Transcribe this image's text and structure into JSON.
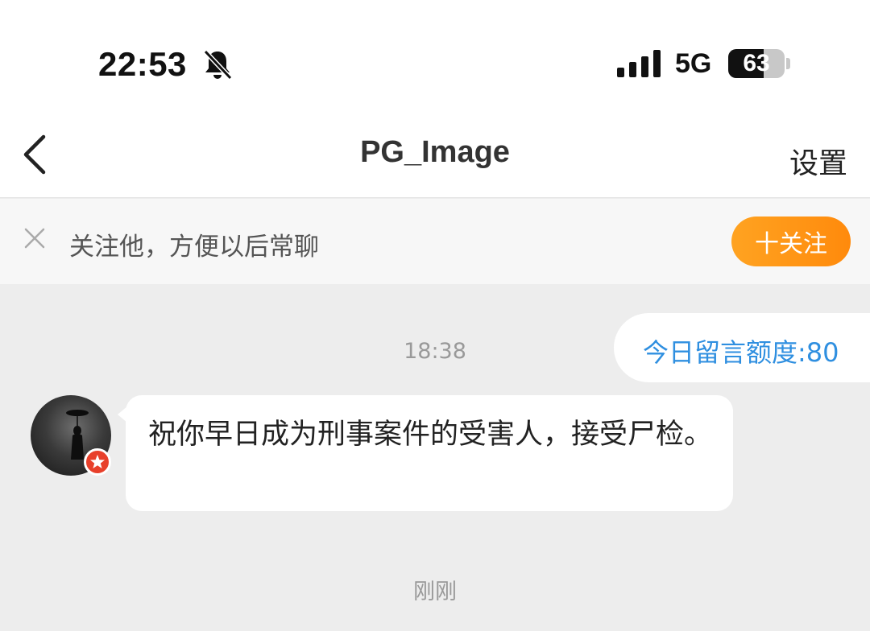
{
  "status_bar": {
    "time": "22:53",
    "network": "5G",
    "battery": "63",
    "battery_level": 0.63,
    "icons": [
      "bell-slash-icon",
      "signal-bars-icon",
      "battery-icon"
    ]
  },
  "nav": {
    "title": "PG_Image",
    "settings_label": "设置",
    "back_icon": "chevron-left-icon"
  },
  "follow_banner": {
    "text": "关注他，方便以后常聊",
    "button_label": "十关注",
    "dismiss_icon": "close-icon"
  },
  "chat": {
    "timestamp_1": "18:38",
    "quota_label": "今日留言额度:80",
    "message": {
      "text": "祝你早日成为刑事案件的受害人，接受尸检。",
      "avatar_icon": "avatar-icon",
      "badge_icon": "star-badge-icon"
    },
    "timestamp_2": "刚刚"
  },
  "colors": {
    "accent_orange": "#ff8a0c",
    "quota_blue": "#2f8fe0",
    "badge_red": "#e8402b",
    "chat_bg": "#ededed"
  }
}
